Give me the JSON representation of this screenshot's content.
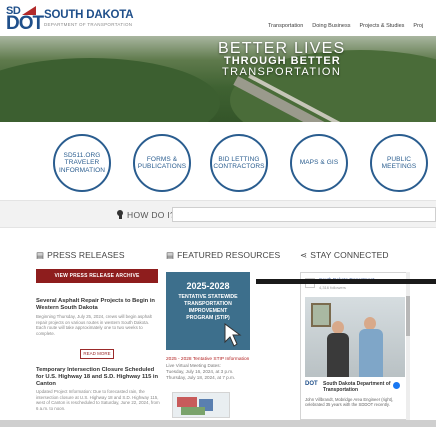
{
  "header": {
    "logo_sd": "SD",
    "logo_dot": "DOT",
    "brand_name": "SOUTH DAKOTA",
    "brand_sub": "DEPARTMENT OF TRANSPORTATION",
    "nav": [
      "Transportation",
      "Doing Business",
      "Projects & Studies",
      "Proj"
    ]
  },
  "hero": {
    "line1": "BETTER LIVES",
    "line2": "THROUGH BETTER",
    "line3": "TRANSPORTATION"
  },
  "quick_links": [
    {
      "label": "SD511.ORG\nTRAVELER\nINFORMATION"
    },
    {
      "label": "FORMS &\nPUBLICATIONS"
    },
    {
      "label": "BID LETTING\nCONTRACTORS"
    },
    {
      "label": "MAPS & GIS"
    },
    {
      "label": "PUBLIC\nMEETINGS"
    }
  ],
  "how_do_i": {
    "label": "HOW DO I?",
    "icon": "lightbulb-icon"
  },
  "press": {
    "title": "PRESS RELEASES",
    "archive_button": "VIEW PRESS RELEASE ARCHIVE",
    "items": [
      {
        "title": "Several Asphalt Repair Projects to Begin in Western South Dakota",
        "body": "Beginning Thursday, July 25, 2024, crews will begin asphalt repair projects on various routes in western South Dakota. Each route will take approximately one to two weeks to complete."
      },
      {
        "title": "Temporary Intersection Closure Scheduled for U.S. Highway 18 and S.D. Highway 115 in Canton",
        "body": "Updated Project Information: Due to forecasted rain, the intersection closure at U.S. Highway 18 and S.D. Highway 115, west of Canton is rescheduled to Saturday, June 22, 2024, from 6 a.m. to noon."
      }
    ],
    "read_more": "READ MORE"
  },
  "featured": {
    "title": "FEATURED RESOURCES",
    "stip_title": "2025-2028",
    "stip_sub": "TENTATIVE STATEWIDE\nTRANSPORTATION\nIMPROVEMENT\nPROGRAM (STIP)",
    "stip_link": "2025 - 2028 Tentative STIP Information",
    "stip_info": "Live Virtual Meeting Dates:\nTuesday, July 16, 2024, at 3 p.m.\nThursday, July 18, 2024, at 7 p.m."
  },
  "social": {
    "title": "STAY CONNECTED",
    "page_name": "South Dakota Department",
    "followers": "4,316 followers",
    "post_author": "South Dakota Department of Transportation",
    "post_text": "John Villbrandt, Mobridge Area Engineer (right), celebrated 35 years with the SDDOT recently."
  }
}
